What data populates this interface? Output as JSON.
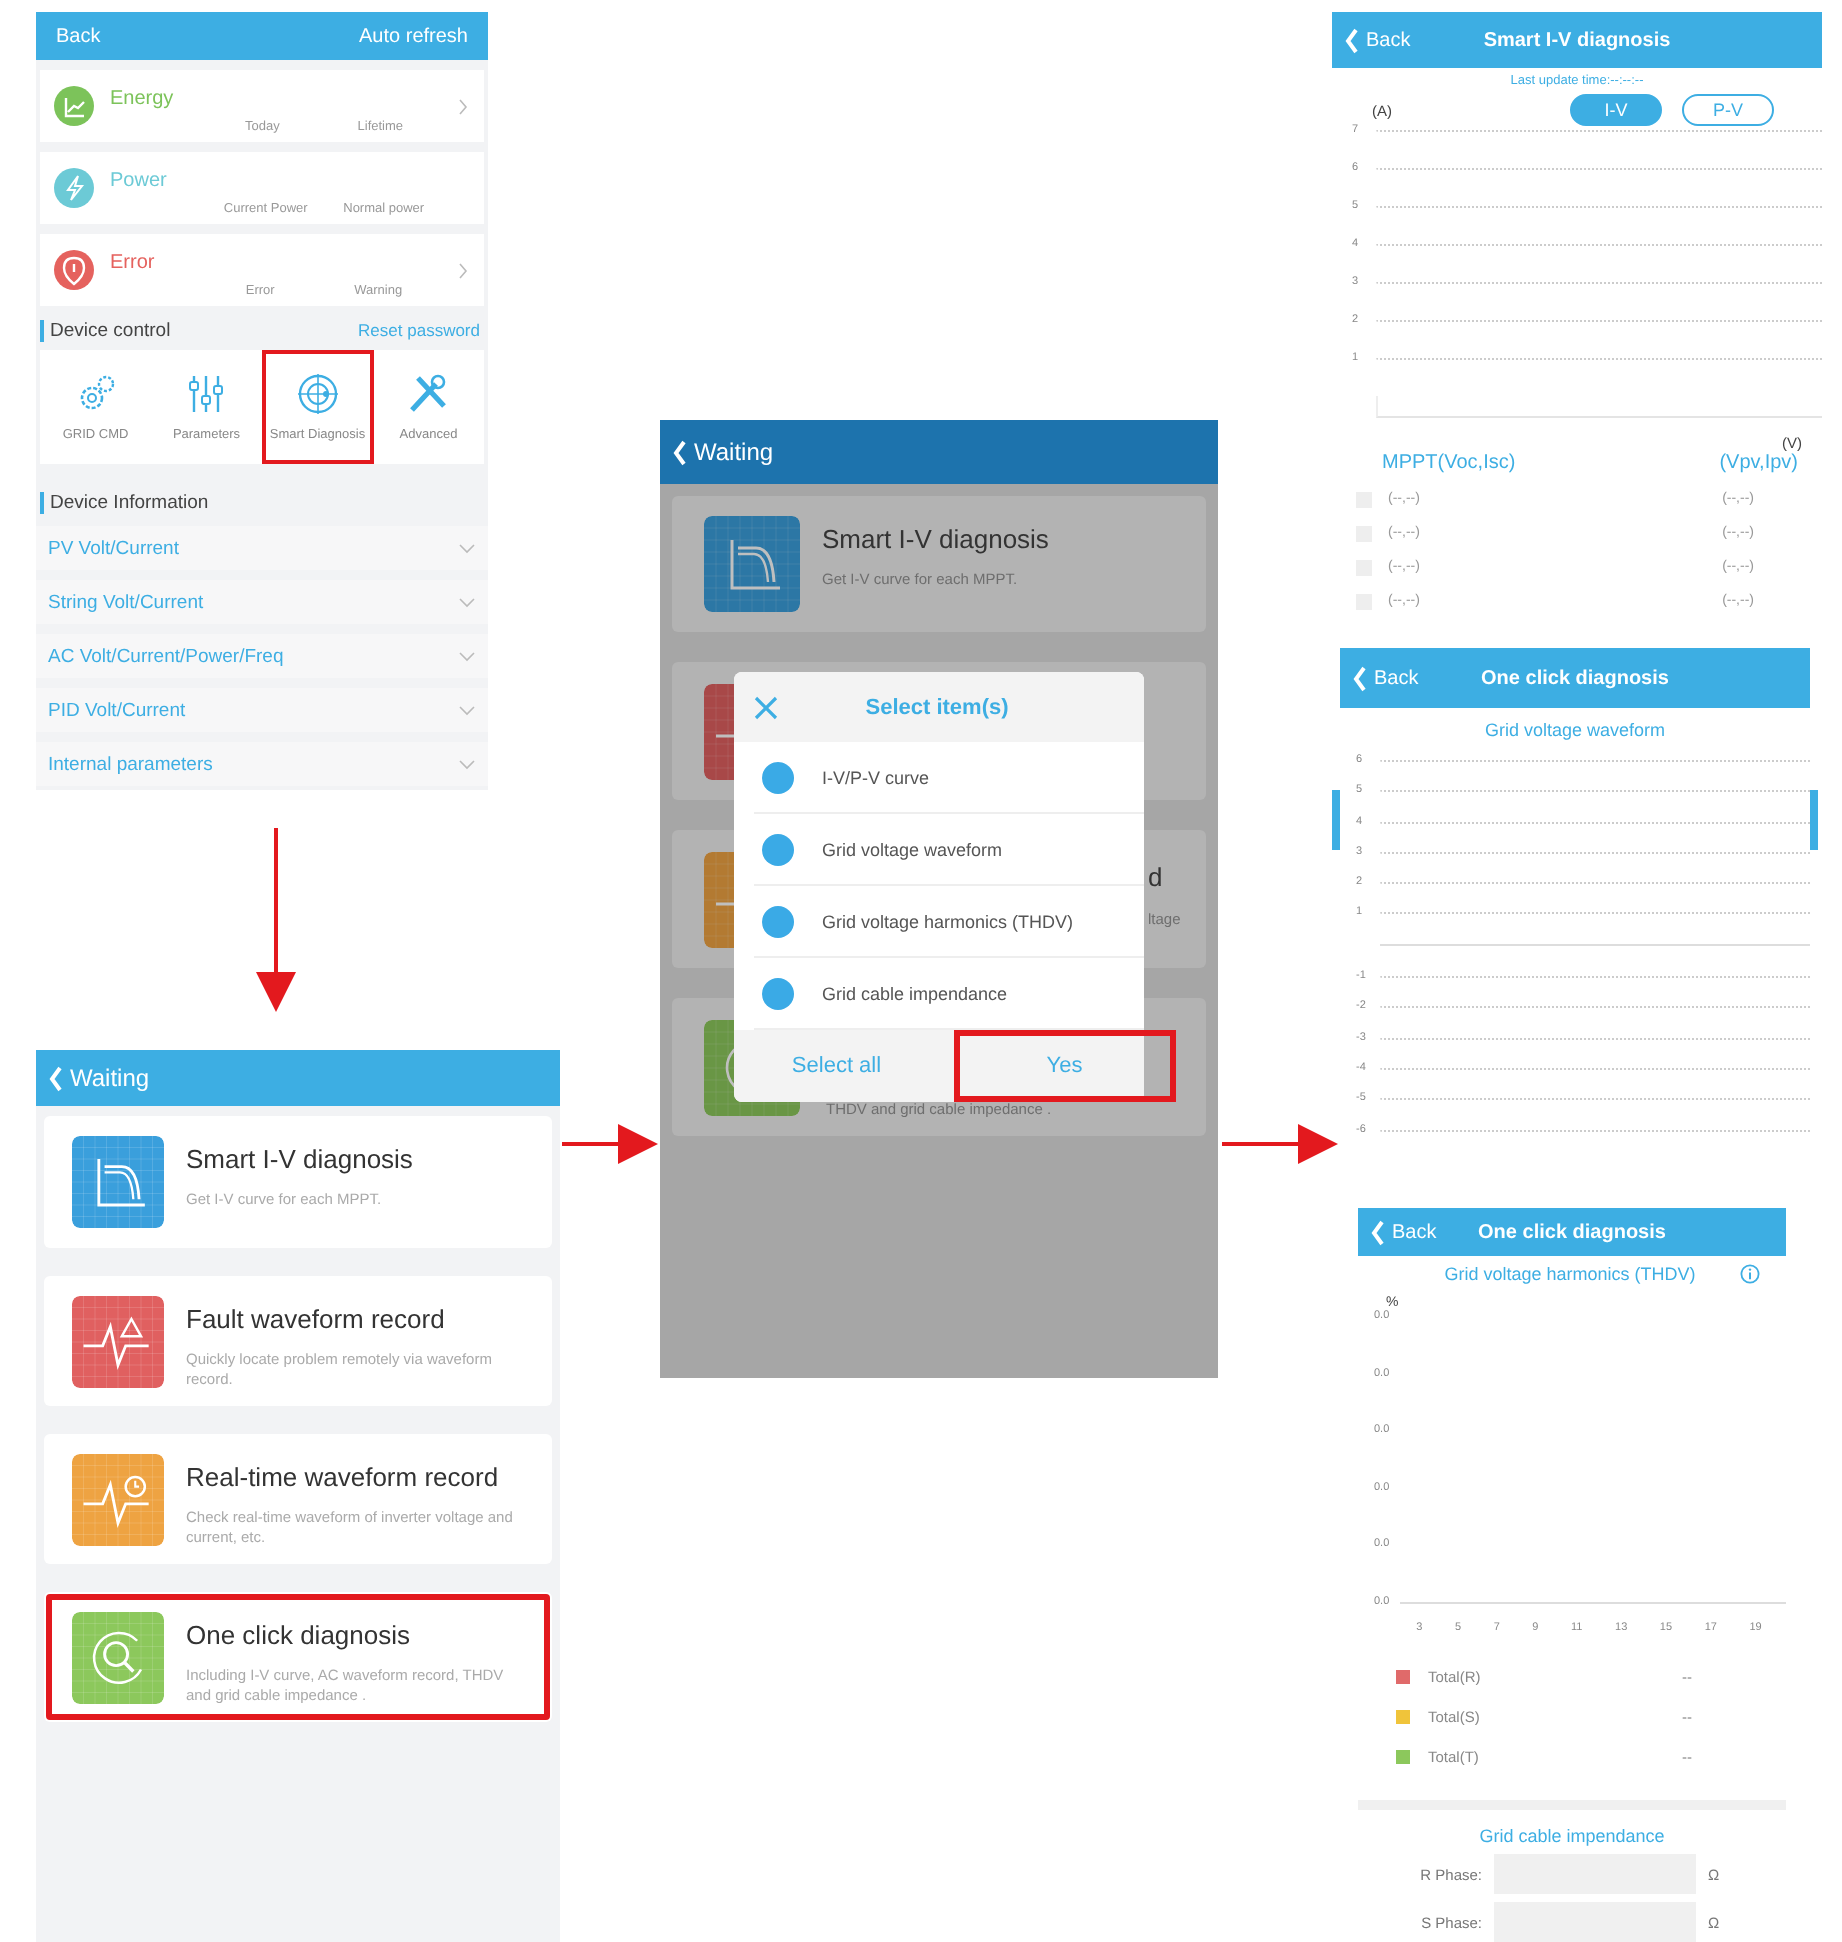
{
  "device_screen": {
    "back": "Back",
    "action": "Auto refresh",
    "summary_cards": [
      {
        "kind": "energy",
        "title": "Energy",
        "labels": [
          "Today",
          "Lifetime"
        ],
        "chevron": true
      },
      {
        "kind": "power",
        "title": "Power",
        "labels": [
          "Current Power",
          "Normal power"
        ],
        "chevron": false
      },
      {
        "kind": "error",
        "title": "Error",
        "labels": [
          "Error",
          "Warning"
        ],
        "chevron": true
      }
    ],
    "control_section": {
      "title": "Device control",
      "link": "Reset password",
      "items": [
        {
          "kind": "gears",
          "label": "GRID CMD",
          "highlighted": false
        },
        {
          "kind": "sliders",
          "label": "Parameters",
          "highlighted": false
        },
        {
          "kind": "target",
          "label": "Smart Diagnosis",
          "highlighted": true
        },
        {
          "kind": "tools",
          "label": "Advanced",
          "highlighted": false
        }
      ]
    },
    "info_section": {
      "title": "Device Information",
      "rows": [
        {
          "label": "PV Volt/Current",
          "expanded": false
        },
        {
          "label": "String Volt/Current",
          "expanded": false
        },
        {
          "label": "AC Volt/Current/Power/Freq",
          "expanded": false
        },
        {
          "label": "PID Volt/Current",
          "expanded": false
        },
        {
          "label": "Internal parameters",
          "expanded": false
        }
      ]
    }
  },
  "diagnosis_menu": {
    "title": "Waiting",
    "items": [
      {
        "kind": "iv",
        "title": "Smart I-V diagnosis",
        "description": "Get I-V curve for each MPPT.",
        "highlighted": false
      },
      {
        "kind": "fault",
        "title": "Fault waveform record",
        "description": "Quickly locate problem remotely via waveform record.",
        "highlighted": false
      },
      {
        "kind": "realtime",
        "title": "Real-time waveform record",
        "description": "Check real-time waveform of inverter voltage and current, etc.",
        "highlighted": false
      },
      {
        "kind": "oneclick",
        "title": "One click diagnosis",
        "description": "Including I-V curve, AC waveform record, THDV and grid cable impedance .",
        "highlighted": true
      }
    ]
  },
  "dialog_screen": {
    "title": "Waiting",
    "cards": [
      {
        "kind": "iv",
        "title": "Smart I-V diagnosis",
        "description": "Get I-V curve for each MPPT."
      },
      {
        "kind": "fault"
      },
      {
        "kind": "realtime",
        "title": "d",
        "description": "ltage"
      },
      {
        "kind": "oneclick",
        "description": "THDV and grid cable impedance ."
      }
    ],
    "dialog": {
      "title": "Select item(s)",
      "items": [
        {
          "label": "I-V/P-V curve",
          "checked": true
        },
        {
          "label": "Grid voltage waveform",
          "checked": true
        },
        {
          "label": "Grid voltage harmonics (THDV)",
          "checked": true
        },
        {
          "label": "Grid cable impendance",
          "checked": true
        }
      ],
      "buttons": [
        {
          "label": "Select all",
          "highlighted": false
        },
        {
          "label": "Yes",
          "highlighted": true
        }
      ]
    }
  },
  "iv_screen": {
    "back": "Back",
    "title": "Smart I-V diagnosis",
    "update": "Last update time:--:--:--",
    "tabs": [
      {
        "label": "I-V",
        "selected": true
      },
      {
        "label": "P-V",
        "selected": false
      }
    ],
    "y_unit": "(A)",
    "y_ticks": [
      "7",
      "6",
      "5",
      "4",
      "3",
      "2",
      "1"
    ],
    "x_unit": "(V)",
    "columns": [
      "MPPT(Voc,Isc)",
      "(Vpv,Ipv)"
    ],
    "rows": [
      {
        "checked": false,
        "mppt": "(--,--)",
        "pv": "(--,--)"
      },
      {
        "checked": false,
        "mppt": "(--,--)",
        "pv": "(--,--)"
      },
      {
        "checked": false,
        "mppt": "(--,--)",
        "pv": "(--,--)"
      },
      {
        "checked": false,
        "mppt": "(--,--)",
        "pv": "(--,--)"
      }
    ]
  },
  "waveform_screen": {
    "back": "Back",
    "title": "One click diagnosis",
    "chart_title": "Grid voltage waveform",
    "y_ticks_upper": [
      "6",
      "5",
      "4",
      "3",
      "2",
      "1"
    ],
    "y_ticks_lower": [
      "-1",
      "-2",
      "-3",
      "-4",
      "-5",
      "-6"
    ]
  },
  "thdv_screen": {
    "back": "Back",
    "title": "One click diagnosis",
    "chart_title": "Grid voltage harmonics (THDV)",
    "y_unit": "%",
    "y_ticks": [
      "0.0",
      "0.0",
      "0.0",
      "0.0",
      "0.0",
      "0.0"
    ],
    "x_ticks": [
      "3",
      "5",
      "7",
      "9",
      "11",
      "13",
      "15",
      "17",
      "19"
    ],
    "legend": [
      {
        "label": "Total(R)",
        "value": "--",
        "color": "#e06a6a"
      },
      {
        "label": "Total(S)",
        "value": "--",
        "color": "#f0c43a"
      },
      {
        "label": "Total(T)",
        "value": "--",
        "color": "#8cc85c"
      }
    ],
    "impedance_title": "Grid cable impendance",
    "phases": [
      {
        "label": "R Phase:",
        "unit": "Ω"
      },
      {
        "label": "S Phase:",
        "unit": "Ω"
      }
    ]
  }
}
